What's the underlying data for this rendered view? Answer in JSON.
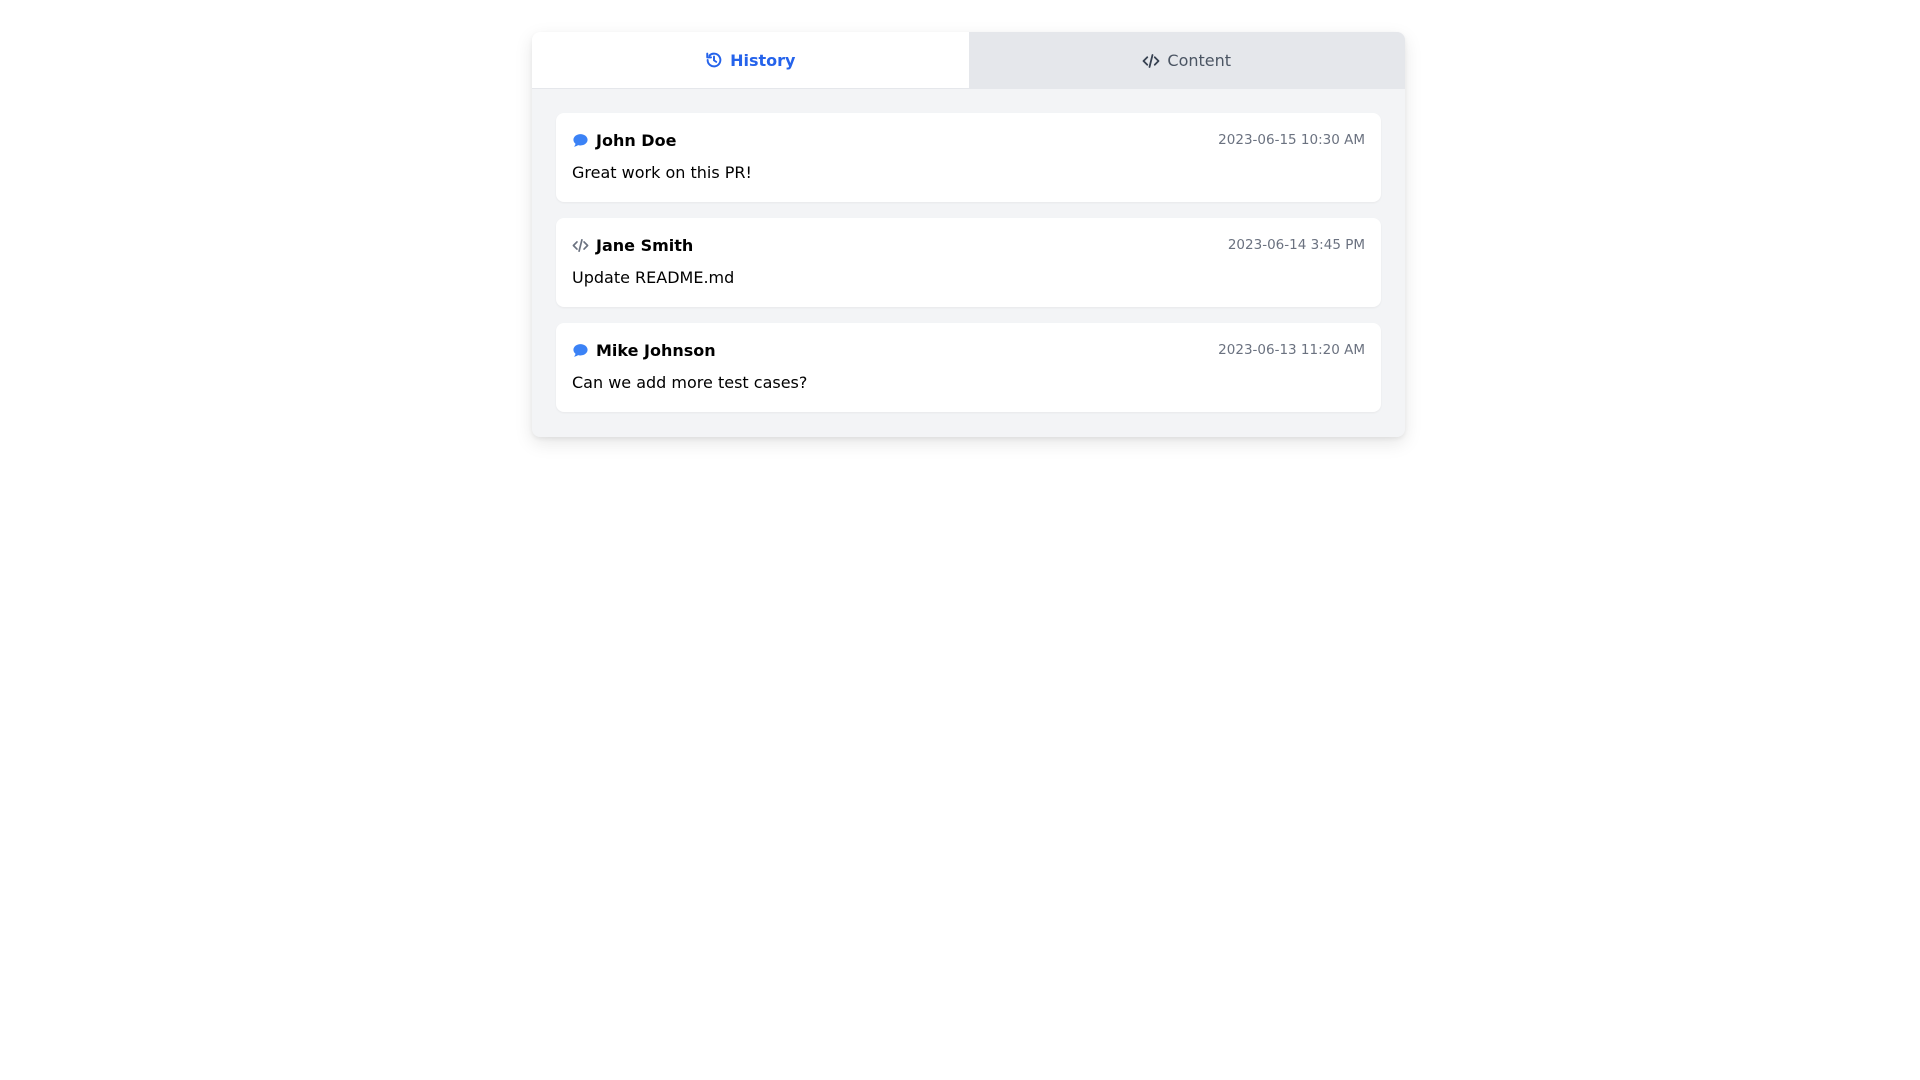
{
  "tabs": [
    {
      "label": "History",
      "icon": "history-icon",
      "active": true
    },
    {
      "label": "Content",
      "icon": "code-icon",
      "active": false
    }
  ],
  "entries": [
    {
      "icon": "comment-icon",
      "name": "John Doe",
      "time": "2023-06-15 10:30 AM",
      "message": "Great work on this PR!"
    },
    {
      "icon": "code-icon",
      "name": "Jane Smith",
      "time": "2023-06-14 3:45 PM",
      "message": "Update README.md"
    },
    {
      "icon": "comment-icon",
      "name": "Mike Johnson",
      "time": "2023-06-13 11:20 AM",
      "message": "Can we add more test cases?"
    }
  ],
  "colors": {
    "accent": "#2563eb",
    "comment_icon": "#3b82f6",
    "code_icon": "#6b7280",
    "muted": "#6b7280"
  }
}
